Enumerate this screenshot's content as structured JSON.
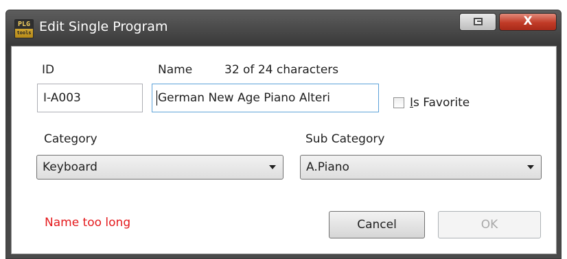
{
  "window": {
    "title": "Edit Single Program",
    "app_icon": {
      "top_text": "PLG",
      "bottom_text": "tools"
    },
    "close_glyph": "X"
  },
  "form": {
    "id_label": "ID",
    "id_value": "I-A003",
    "name_label": "Name",
    "name_count": "32 of 24 characters",
    "name_value": "German New Age Piano Alteri",
    "favorite_label_prefix": "I",
    "favorite_label_rest": "s Favorite",
    "favorite_checked": false,
    "category_label": "Category",
    "category_value": "Keyboard",
    "subcategory_label": "Sub Category",
    "subcategory_value": "A.Piano",
    "error_text": "Name too long",
    "cancel_label": "Cancel",
    "ok_label": "OK"
  },
  "colors": {
    "error": "#e4191c",
    "close_button": "#c13b27",
    "focus_border": "#5aa0d8"
  },
  "icons": [
    "app-icon",
    "restore-icon",
    "close-icon",
    "chevron-down-icon"
  ]
}
